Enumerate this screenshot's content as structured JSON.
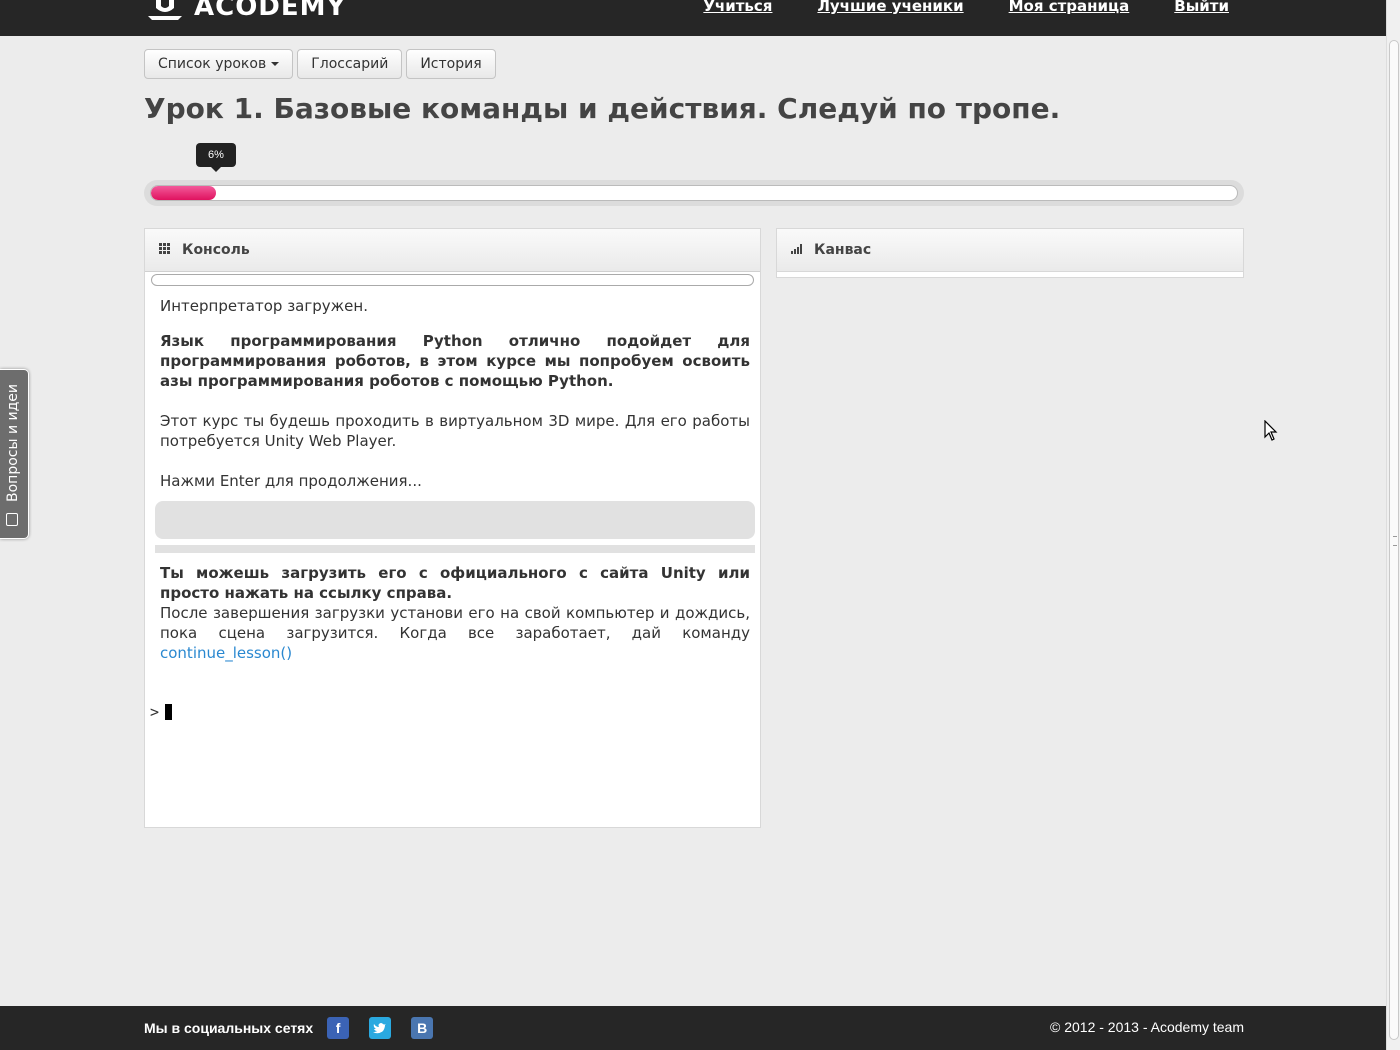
{
  "brand": {
    "name": "ACODEMY"
  },
  "nav": {
    "items": [
      "Учиться",
      "Лучшие ученики",
      "Моя страница",
      "Выйти"
    ]
  },
  "toolbar": {
    "lessons_label": "Список уроков",
    "glossary_label": "Глоссарий",
    "history_label": "История"
  },
  "lesson": {
    "title": "Урок 1. Базовые команды и действия. Следуй по тропе.",
    "progress_label": "6%",
    "progress_fraction": 0.06
  },
  "console": {
    "title": "Консоль",
    "lines": {
      "loaded": "Интерпретатор загружен.",
      "intro": "Язык программирования Python отлично подойдет для программирования роботов, в этом курсе мы попробуем освоить азы программирования роботов с помощью Python.",
      "unity": "Этот курс ты будешь проходить в виртуальном 3D мире. Для его работы потребуется Unity Web Player.",
      "enter": "Нажми Enter для продолжения...",
      "download": "Ты можешь загрузить его с официального с сайта Unity или просто нажать на ссылку справа.",
      "after": "После завершения загрузки установи его на свой компьютер и дождись, пока сцена загрузится. Когда все заработает, дай команду",
      "command": "continue_lesson()"
    },
    "prompt": ">"
  },
  "canvas": {
    "title": "Канвас"
  },
  "feedback": {
    "label": "Вопросы и идеи"
  },
  "footer": {
    "social_label": "Мы в социальных сетях",
    "copyright": "© 2012 - 2013 - Acodemy team"
  },
  "colors": {
    "navbar": "#262626",
    "progress": "#e0125f",
    "link": "#2a88d0"
  }
}
